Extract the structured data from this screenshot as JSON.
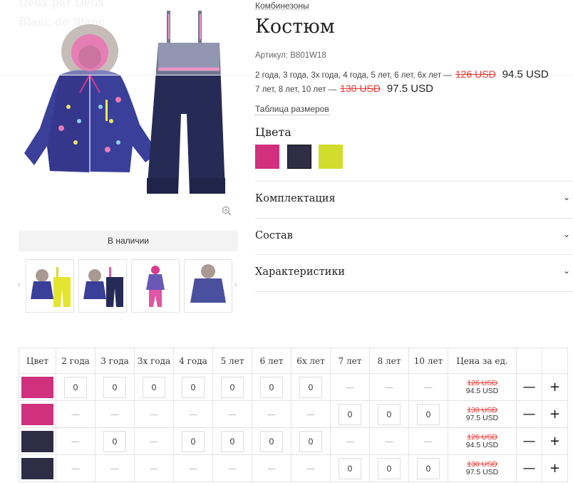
{
  "ghost_text": [
    "Deux par Deux",
    "Blanc de Blanc"
  ],
  "product": {
    "category": "Комбинезоны",
    "title": "Костюм",
    "sku": "Артикул: B801W18",
    "prices": [
      {
        "sizes": "2 года, 3 года, 3х года, 4 года, 5 лет, 6 лет, 6х лет —",
        "old": "126 USD",
        "new": "94.5 USD"
      },
      {
        "sizes": "7 лет, 8 лет, 10 лет —",
        "old": "130 USD",
        "new": "97.5 USD"
      }
    ],
    "size_table_link": "Таблица размеров",
    "colors_title": "Цвета",
    "colors": [
      "#d0307e",
      "#2f2c45",
      "#d2dc2c"
    ],
    "availability": "В наличии"
  },
  "accordion": [
    {
      "label": "Комплектация"
    },
    {
      "label": "Состав"
    },
    {
      "label": "Характеристики"
    }
  ],
  "icons": {
    "zoom": "zoom-icon",
    "chevron": "chevron-down-icon",
    "arrow_left": "‹",
    "arrow_right": "›",
    "minus": "—",
    "plus": "+"
  },
  "order_table": {
    "headers": [
      "Цвет",
      "2 года",
      "3 года",
      "3х года",
      "4 года",
      "5 лет",
      "6 лет",
      "6х лет",
      "7 лет",
      "8 лет",
      "10 лет",
      "Цена за ед.",
      "",
      ""
    ],
    "rows": [
      {
        "color": "#d0307e",
        "cells": [
          "0",
          "0",
          "0",
          "0",
          "0",
          "0",
          "0",
          "—",
          "—",
          "—"
        ],
        "old": "126 USD",
        "new": "94.5 USD"
      },
      {
        "color": "#d0307e",
        "cells": [
          "—",
          "—",
          "—",
          "—",
          "—",
          "—",
          "—",
          "0",
          "0",
          "0"
        ],
        "old": "130 USD",
        "new": "97.5 USD"
      },
      {
        "color": "#2f2c45",
        "cells": [
          "—",
          "0",
          "—",
          "0",
          "0",
          "0",
          "0",
          "—",
          "—",
          "—"
        ],
        "old": "126 USD",
        "new": "94.5 USD"
      },
      {
        "color": "#2f2c45",
        "cells": [
          "—",
          "—",
          "—",
          "—",
          "—",
          "—",
          "—",
          "0",
          "0",
          "0"
        ],
        "old": "130 USD",
        "new": "97.5 USD"
      }
    ]
  }
}
